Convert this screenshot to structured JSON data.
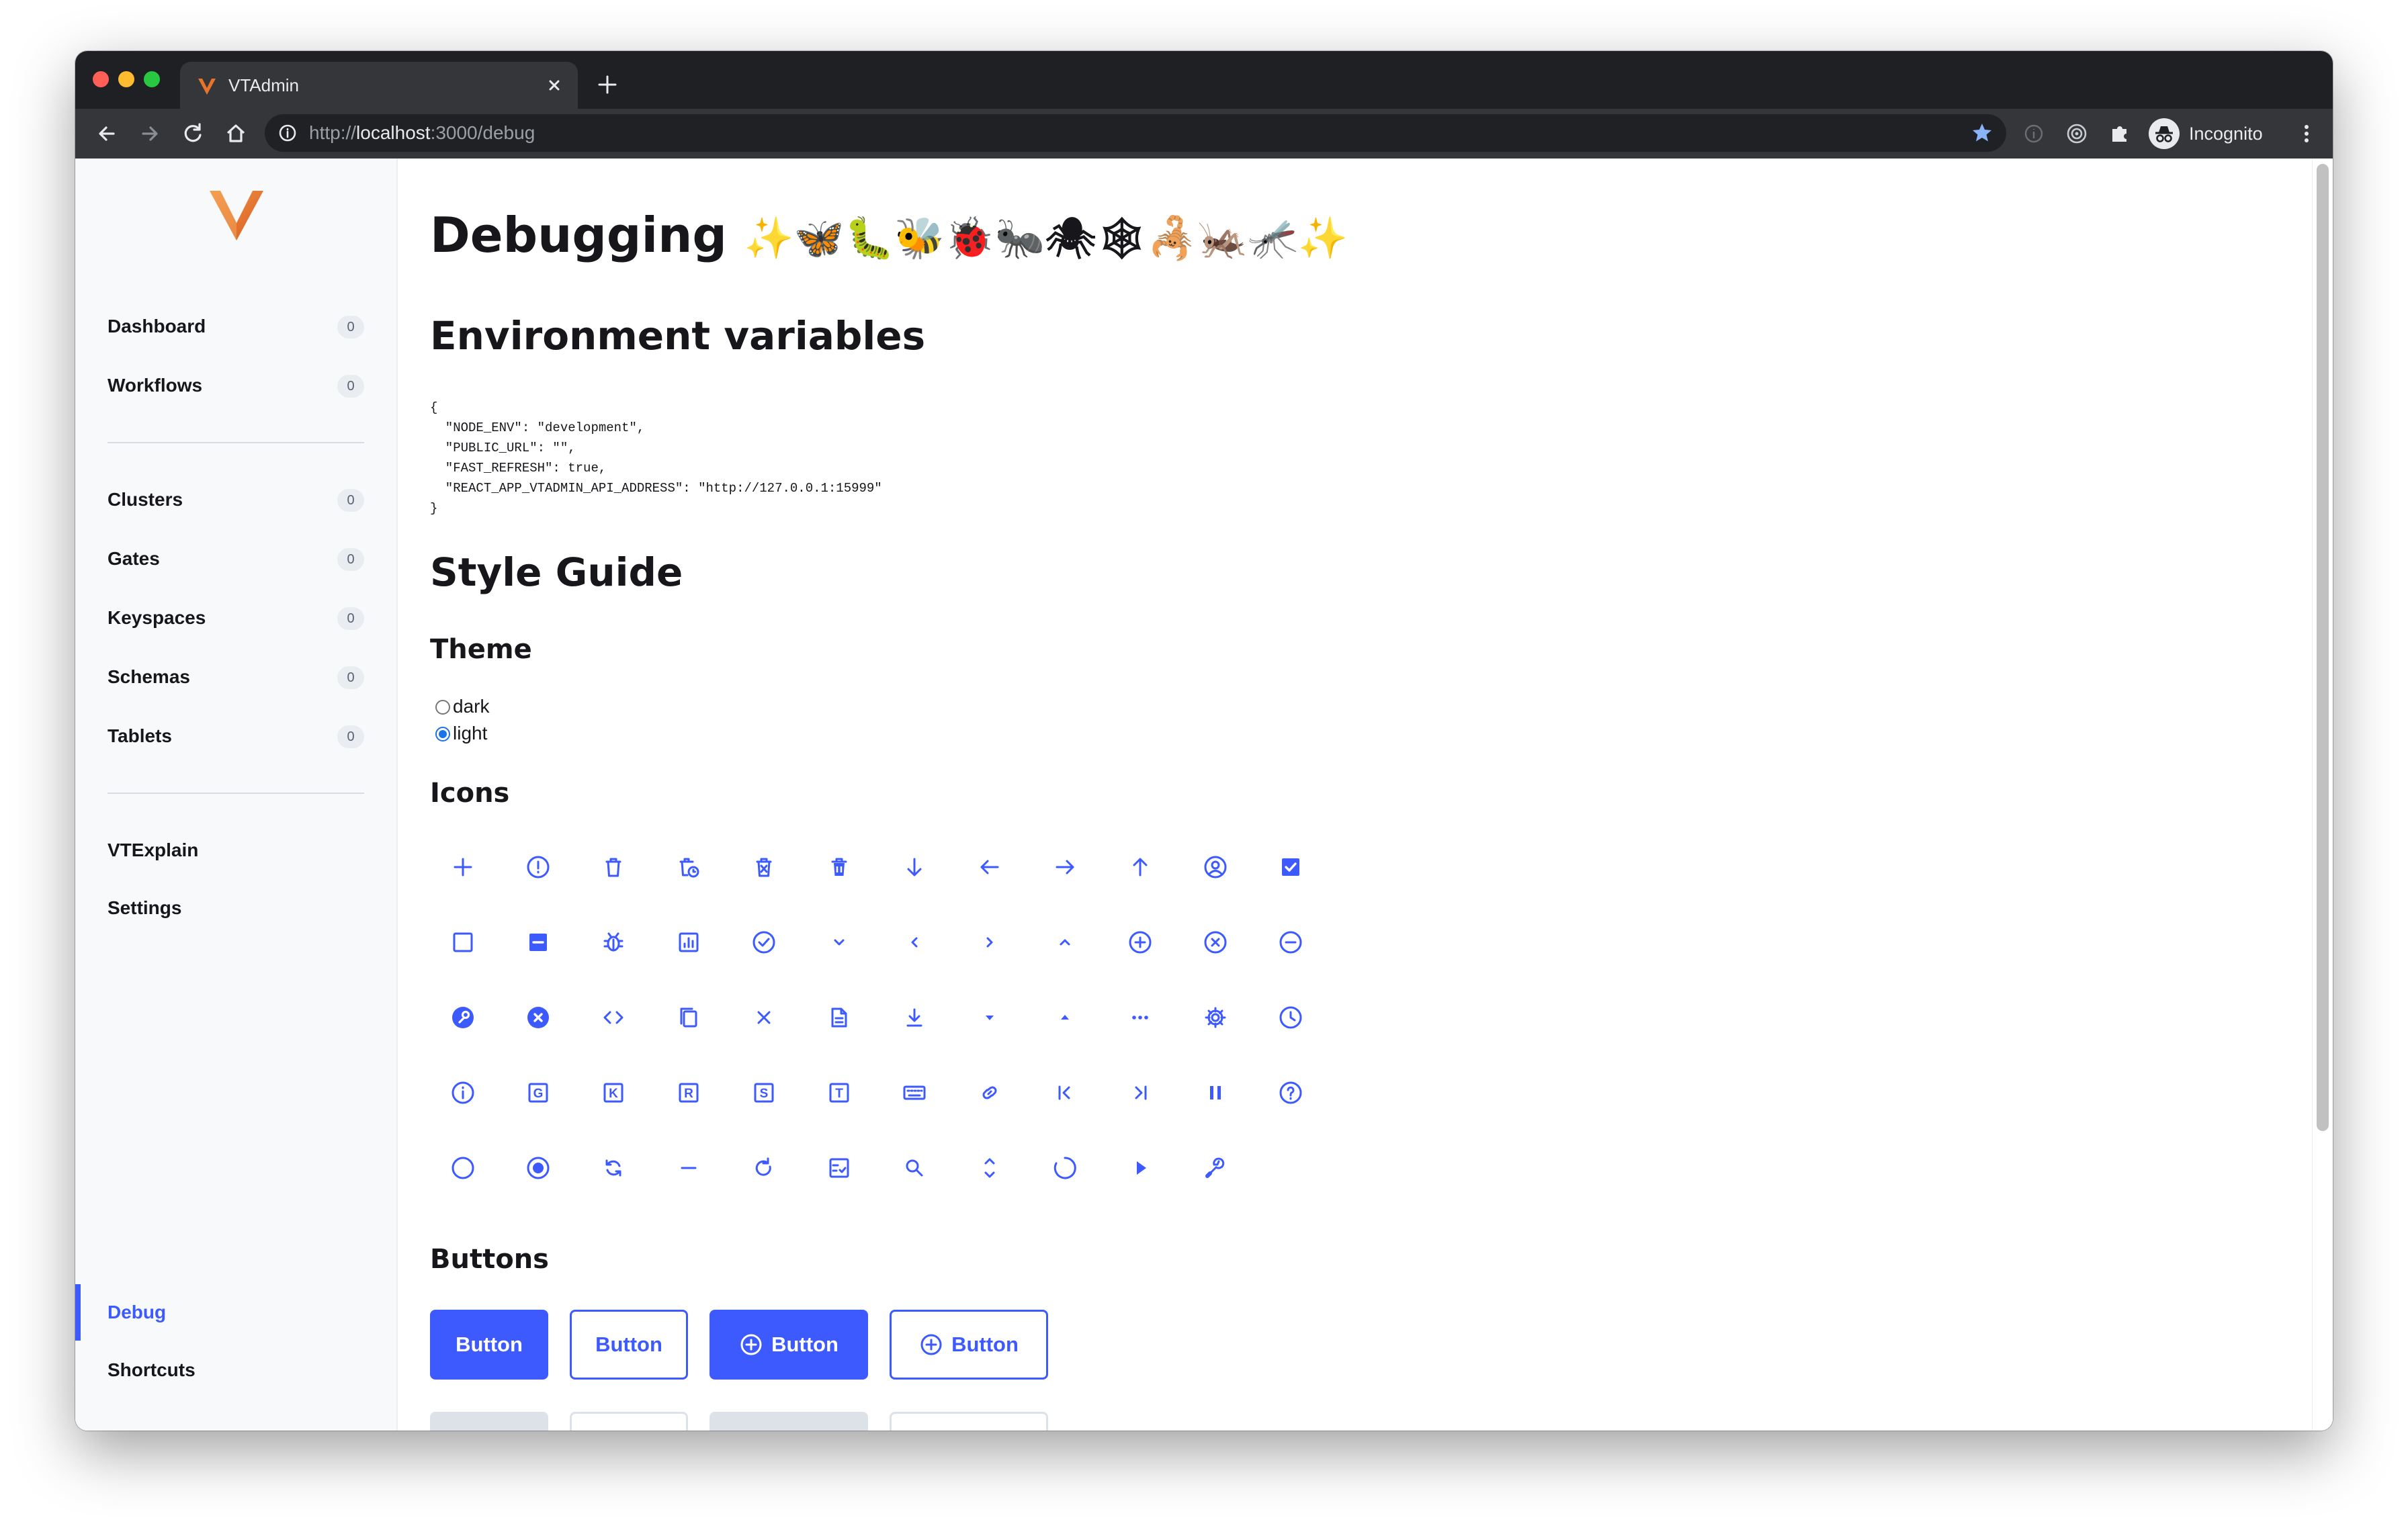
{
  "browser": {
    "tab_title": "VTAdmin",
    "url_scheme": "http://",
    "url_host": "localhost",
    "url_rest": ":3000/debug",
    "profile_label": "Incognito"
  },
  "sidebar": {
    "groups": [
      [
        {
          "label": "Dashboard",
          "count": "0"
        },
        {
          "label": "Workflows",
          "count": "0"
        }
      ],
      [
        {
          "label": "Clusters",
          "count": "0"
        },
        {
          "label": "Gates",
          "count": "0"
        },
        {
          "label": "Keyspaces",
          "count": "0"
        },
        {
          "label": "Schemas",
          "count": "0"
        },
        {
          "label": "Tablets",
          "count": "0"
        }
      ],
      [
        {
          "label": "VTExplain"
        },
        {
          "label": "Settings"
        }
      ]
    ],
    "bottom": [
      {
        "label": "Debug",
        "active": true
      },
      {
        "label": "Shortcuts"
      }
    ]
  },
  "main": {
    "title": "Debugging",
    "title_emoji": "✨🦋🐛🐝🐞🐜🕷🕸🦂🦗🦟✨",
    "env_heading": "Environment variables",
    "env_json": "{\n  \"NODE_ENV\": \"development\",\n  \"PUBLIC_URL\": \"\",\n  \"FAST_REFRESH\": true,\n  \"REACT_APP_VTADMIN_API_ADDRESS\": \"http://127.0.0.1:15999\"\n}",
    "style_guide_heading": "Style Guide",
    "theme_heading": "Theme",
    "theme_options": [
      {
        "label": "dark",
        "checked": false
      },
      {
        "label": "light",
        "checked": true
      }
    ],
    "icons_heading": "Icons",
    "icons": [
      "add-icon",
      "alert-circle-icon",
      "delete-icon",
      "delete-clock-icon",
      "delete-box-icon",
      "delete-trash-icon",
      "arrow-down-icon",
      "arrow-left-icon",
      "arrow-right-icon",
      "arrow-up-icon",
      "account-circle-icon",
      "checkbox-checked-icon",
      "checkbox-empty-icon",
      "checkbox-indeterminate-icon",
      "bug-icon",
      "chart-icon",
      "check-circle-icon",
      "chevron-down-icon",
      "chevron-left-icon",
      "chevron-right-icon",
      "chevron-up-icon",
      "add-circle-icon",
      "close-circle-icon",
      "remove-circle-icon",
      "wrench-circle-icon",
      "close-circle-filled-icon",
      "code-icon",
      "copy-icon",
      "close-icon",
      "document-icon",
      "download-icon",
      "caret-down-icon",
      "caret-up-icon",
      "more-horizontal-icon",
      "gear-icon",
      "clock-icon",
      "info-icon",
      "gate-icon",
      "keyspace-icon",
      "resource-r-icon",
      "schema-icon",
      "tablet-icon",
      "keyboard-icon",
      "link-icon",
      "first-page-icon",
      "last-page-icon",
      "pause-icon",
      "help-circle-icon",
      "radio-empty-icon",
      "radio-checked-icon",
      "refresh-icon",
      "minus-icon",
      "reload-icon",
      "checklist-icon",
      "search-icon",
      "unfold-icon",
      "spinner-icon",
      "play-icon",
      "wrench-icon"
    ],
    "buttons_heading": "Buttons",
    "buttons": [
      {
        "label": "Button",
        "variant": "primary",
        "icon": false
      },
      {
        "label": "Button",
        "variant": "secondary",
        "icon": false
      },
      {
        "label": "Button",
        "variant": "primary",
        "icon": true
      },
      {
        "label": "Button",
        "variant": "secondary",
        "icon": true
      }
    ]
  },
  "colors": {
    "accent": "#3d5afe",
    "text": "#17171b",
    "sidebar_bg": "#f8f9fb",
    "chrome_dark": "#202124",
    "logo": "#e8732a"
  }
}
